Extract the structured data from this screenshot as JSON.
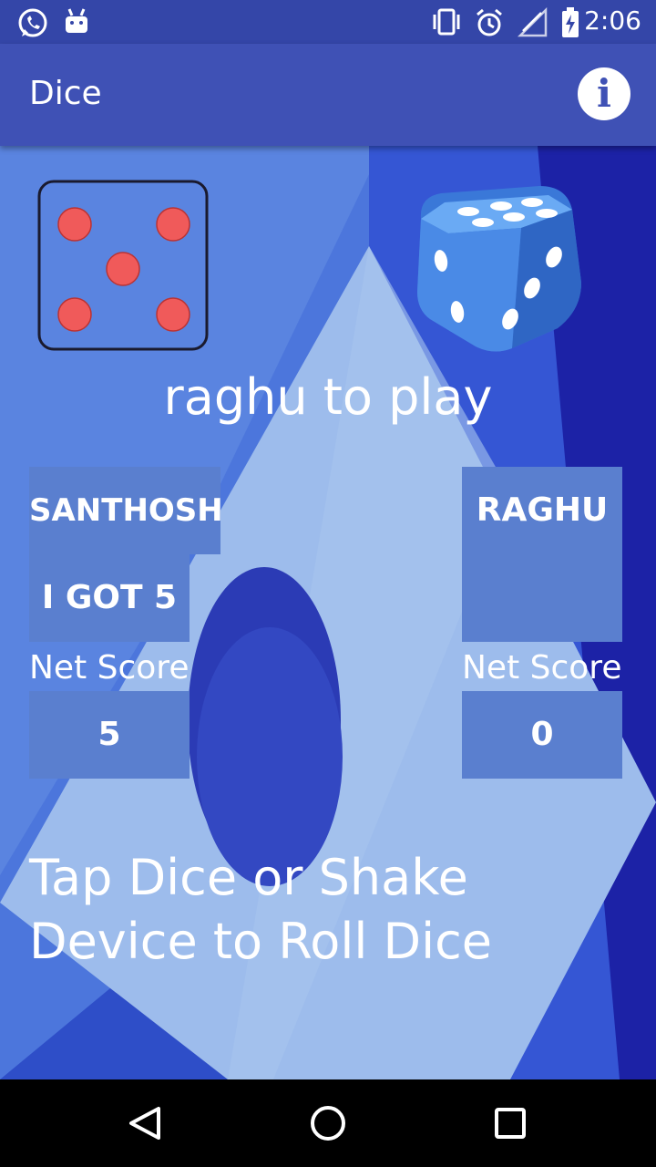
{
  "status_bar": {
    "time": "2:06",
    "left_icons": [
      "whatsapp-icon",
      "android-icon"
    ],
    "right_icons": [
      "vibrate-icon",
      "alarm-icon",
      "signal-icon",
      "battery-charging-icon"
    ]
  },
  "app_bar": {
    "title": "Dice",
    "info_icon": "info-icon"
  },
  "game": {
    "die_face_value": 5,
    "turn_text": "raghu to play",
    "player1": {
      "name": "SANTHOSH",
      "roll_text": "I GOT 5",
      "net_label": "Net Score",
      "net_score": "5"
    },
    "player2": {
      "name": "RAGHU",
      "roll_text": "",
      "net_label": "Net Score",
      "net_score": "0"
    },
    "hint": "Tap Dice or Shake Device to Roll Dice"
  },
  "nav_bar": {
    "icons": [
      "back-icon",
      "home-icon",
      "recents-icon"
    ]
  },
  "colors": {
    "app_bar": "#3f51b5",
    "status_bar": "#3446a8",
    "panel": "#5a7fcf",
    "pip": "#f05a5a"
  }
}
